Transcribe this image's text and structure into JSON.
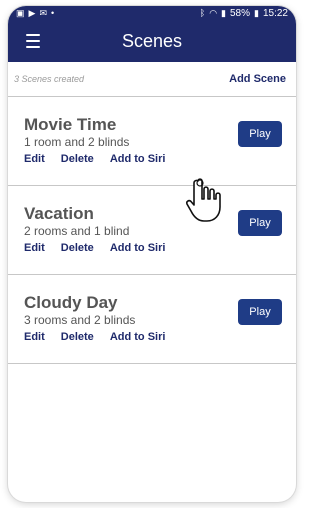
{
  "status_bar": {
    "left_icons": [
      "gallery-icon",
      "play-store-icon",
      "mail-icon"
    ],
    "right_icons": [
      "bluetooth-icon",
      "wifi-icon",
      "signal-icon",
      "battery-icon"
    ],
    "battery_percent": "58%",
    "time": "15:22"
  },
  "app_bar": {
    "title": "Scenes",
    "menu_icon": "hamburger-menu-icon"
  },
  "subheader": {
    "scene_count": "3 Scenes created",
    "add_scene_label": "Add Scene"
  },
  "scenes": [
    {
      "name": "Movie Time",
      "description": "1 room and 2 blinds",
      "actions": [
        "Edit",
        "Delete",
        "Add to Siri"
      ],
      "play_label": "Play"
    },
    {
      "name": "Vacation",
      "description": "2 rooms and 1 blind",
      "actions": [
        "Edit",
        "Delete",
        "Add to Siri"
      ],
      "play_label": "Play"
    },
    {
      "name": "Cloudy Day",
      "description": "3 rooms and 2 blinds",
      "actions": [
        "Edit",
        "Delete",
        "Add to Siri"
      ],
      "play_label": "Play"
    }
  ],
  "pointer": {
    "icon": "hand-pointer-icon"
  },
  "colors": {
    "primary": "#1f2a6b",
    "button": "#1f3c86"
  }
}
